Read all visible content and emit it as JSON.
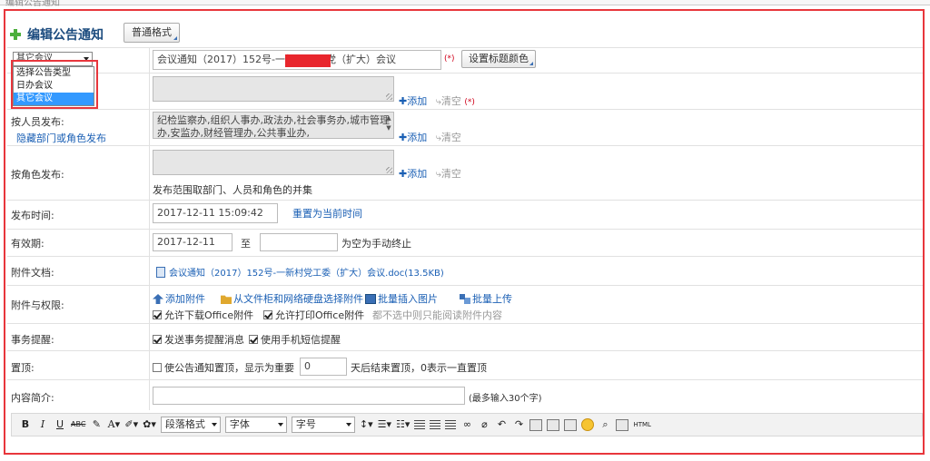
{
  "top": {
    "crumb": "编辑公告通知"
  },
  "header": {
    "title": "编辑公告通知",
    "format_button": "普通格式"
  },
  "type_select": {
    "value": "其它会议",
    "options": [
      "选择公告类型",
      "日办会议",
      "其它会议"
    ],
    "selected_index": 2
  },
  "title_row": {
    "value": "会议通知（2017）152号-一新",
    "value_tail": "党（扩大）会议",
    "required": "(*)",
    "color_button": "设置标题颜色"
  },
  "row2": {
    "add": "添加",
    "clear": "清空",
    "required": "(*)"
  },
  "person_row": {
    "label": "按人员发布:",
    "hide_link": "隐藏部门或角色发布",
    "content": "纪检监察办,组织人事办,政法办,社会事务办,城市管理办,安监办,财经管理办,公共事业办,",
    "add": "添加",
    "clear": "清空"
  },
  "role_row": {
    "label": "按角色发布:",
    "add": "添加",
    "clear": "清空",
    "note": "发布范围取部门、人员和角色的并集"
  },
  "publish_time": {
    "label": "发布时间:",
    "value": "2017-12-11 15:09:42",
    "reset": "重置为当前时间"
  },
  "valid_period": {
    "label": "有效期:",
    "start": "2017-12-11",
    "to": "至",
    "end": "",
    "note": "为空为手动终止"
  },
  "attachment": {
    "label": "附件文档:",
    "file": "会议通知（2017）152号-一新村党工委（扩大）会议.doc(13.5KB)"
  },
  "attach_perm": {
    "label": "附件与权限:",
    "add_attach": "添加附件",
    "from_disk": "从文件柜和网络硬盘选择附件",
    "batch_image": "批量插入图片",
    "batch_upload": "批量上传",
    "allow_download": "允许下载Office附件",
    "allow_print": "允许打印Office附件",
    "perm_note": "都不选中则只能阅读附件内容"
  },
  "reminder": {
    "label": "事务提醒:",
    "send_msg": "发送事务提醒消息",
    "sms": "使用手机短信提醒"
  },
  "pin": {
    "label": "置顶:",
    "text": "使公告通知置顶，显示为重要",
    "days": "0",
    "days_note": "天后结束置顶，0表示一直置顶"
  },
  "summary": {
    "label": "内容简介:",
    "value": "",
    "note": "(最多输入30个字)"
  },
  "editor_toolbar": {
    "bold": "B",
    "italic": "I",
    "underline": "U",
    "strike": "ABC",
    "font_color": "A",
    "paragraph": "段落格式",
    "font": "字体",
    "size": "字号",
    "html": "HTML"
  }
}
